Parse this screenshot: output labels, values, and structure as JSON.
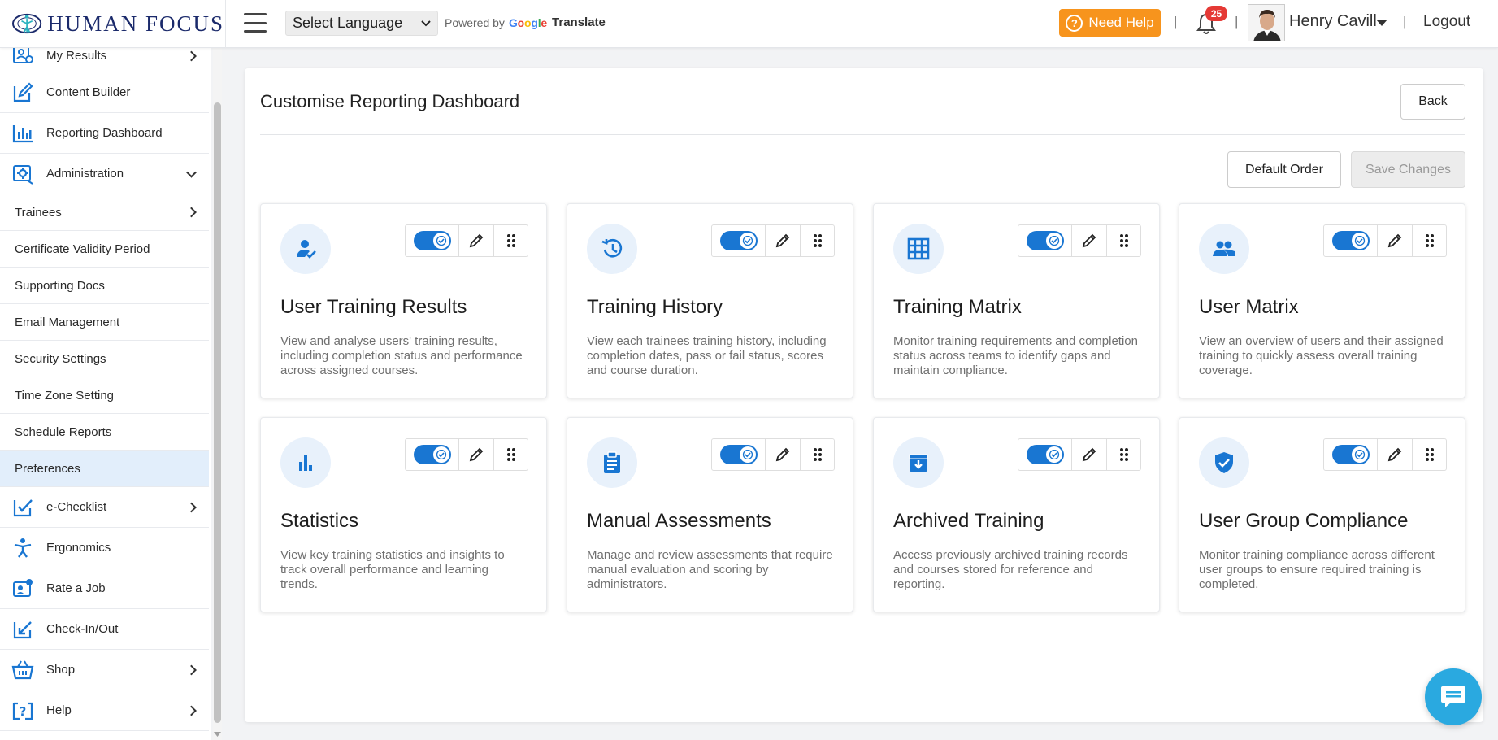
{
  "header": {
    "brand": "HUMAN FOCUS",
    "language_select": "Select Language",
    "powered_by": "Powered by",
    "google": "Google",
    "translate": "Translate",
    "need_help": "Need Help",
    "notification_count": "25",
    "user_name": "Henry Cavill",
    "logout": "Logout",
    "separator": "|"
  },
  "sidebar": {
    "items": [
      {
        "label": "My Results",
        "icon": "results-icon"
      },
      {
        "label": "Content Builder",
        "icon": "edit-icon"
      },
      {
        "label": "Reporting Dashboard",
        "icon": "bar-chart-icon"
      },
      {
        "label": "Administration",
        "icon": "admin-gear-icon"
      }
    ],
    "admin_sub": [
      {
        "label": "Trainees"
      },
      {
        "label": "Certificate Validity Period"
      },
      {
        "label": "Supporting Docs"
      },
      {
        "label": "Email Management"
      },
      {
        "label": "Security Settings"
      },
      {
        "label": "Time Zone Setting"
      },
      {
        "label": "Schedule Reports"
      },
      {
        "label": "Preferences"
      }
    ],
    "bottom_items": [
      {
        "label": "e-Checklist",
        "icon": "checklist-icon"
      },
      {
        "label": "Ergonomics",
        "icon": "ergonomics-icon"
      },
      {
        "label": "Rate a Job",
        "icon": "rate-job-icon"
      },
      {
        "label": "Check-In/Out",
        "icon": "check-in-icon"
      },
      {
        "label": "Shop",
        "icon": "shop-icon"
      },
      {
        "label": "Help",
        "icon": "help-icon"
      }
    ]
  },
  "main": {
    "title": "Customise Reporting Dashboard",
    "back": "Back",
    "default_order": "Default Order",
    "save_changes": "Save Changes",
    "cards": [
      {
        "title": "User Training Results",
        "desc": "View and analyse users' training results, including completion status and performance across assigned courses.",
        "icon": "user-check-icon",
        "enabled": true
      },
      {
        "title": "Training History",
        "desc": "View each trainees training history, including completion dates, pass or fail status, scores and course duration.",
        "icon": "history-icon",
        "enabled": true
      },
      {
        "title": "Training Matrix",
        "desc": "Monitor training requirements and completion status across teams to identify gaps and maintain compliance.",
        "icon": "grid-icon",
        "enabled": true
      },
      {
        "title": "User Matrix",
        "desc": "View an overview of users and their assigned training to quickly assess overall training coverage.",
        "icon": "people-icon",
        "enabled": true
      },
      {
        "title": "Statistics",
        "desc": "View key training statistics and insights to track overall performance and learning trends.",
        "icon": "stats-bar-icon",
        "enabled": true
      },
      {
        "title": "Manual Assessments",
        "desc": "Manage and review assessments that require manual evaluation and scoring by administrators.",
        "icon": "clipboard-icon",
        "enabled": true
      },
      {
        "title": "Archived Training",
        "desc": "Access previously archived training records and courses stored for reference and reporting.",
        "icon": "archive-icon",
        "enabled": true
      },
      {
        "title": "User Group Compliance",
        "desc": "Monitor training compliance across different user groups to ensure required training is completed.",
        "icon": "shield-check-icon",
        "enabled": true
      }
    ]
  },
  "colors": {
    "accent": "#1976d2",
    "help": "#f7941d",
    "badge": "#e53935",
    "chat": "#2aa9e0",
    "active_bg": "#e2eefb"
  }
}
